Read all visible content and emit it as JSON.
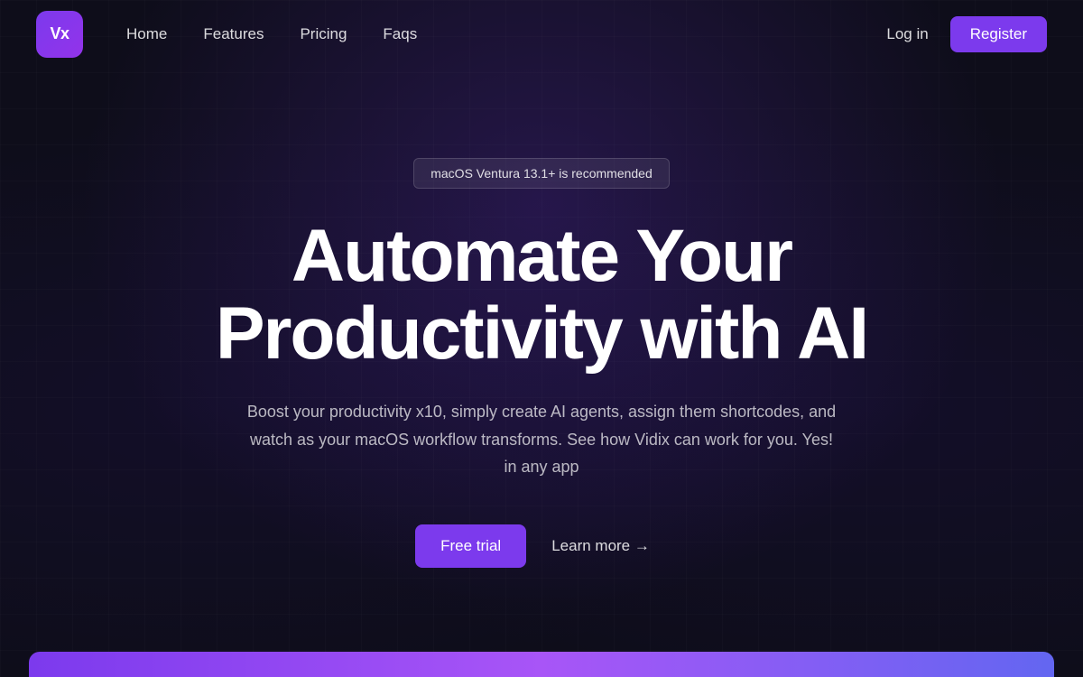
{
  "logo": {
    "text": "Vx"
  },
  "nav": {
    "links": [
      {
        "label": "Home",
        "id": "home"
      },
      {
        "label": "Features",
        "id": "features"
      },
      {
        "label": "Pricing",
        "id": "pricing"
      },
      {
        "label": "Faqs",
        "id": "faqs"
      }
    ],
    "login_label": "Log in",
    "register_label": "Register"
  },
  "hero": {
    "badge": "macOS Ventura 13.1+ is recommended",
    "title_line1": "Automate Your",
    "title_line2": "Productivity with AI",
    "subtitle": "Boost your productivity x10, simply create AI agents, assign them shortcodes, and watch as your macOS workflow transforms. See how Vidix can work for you. Yes! in any app",
    "cta_primary": "Free trial",
    "cta_secondary": "Learn more →"
  }
}
